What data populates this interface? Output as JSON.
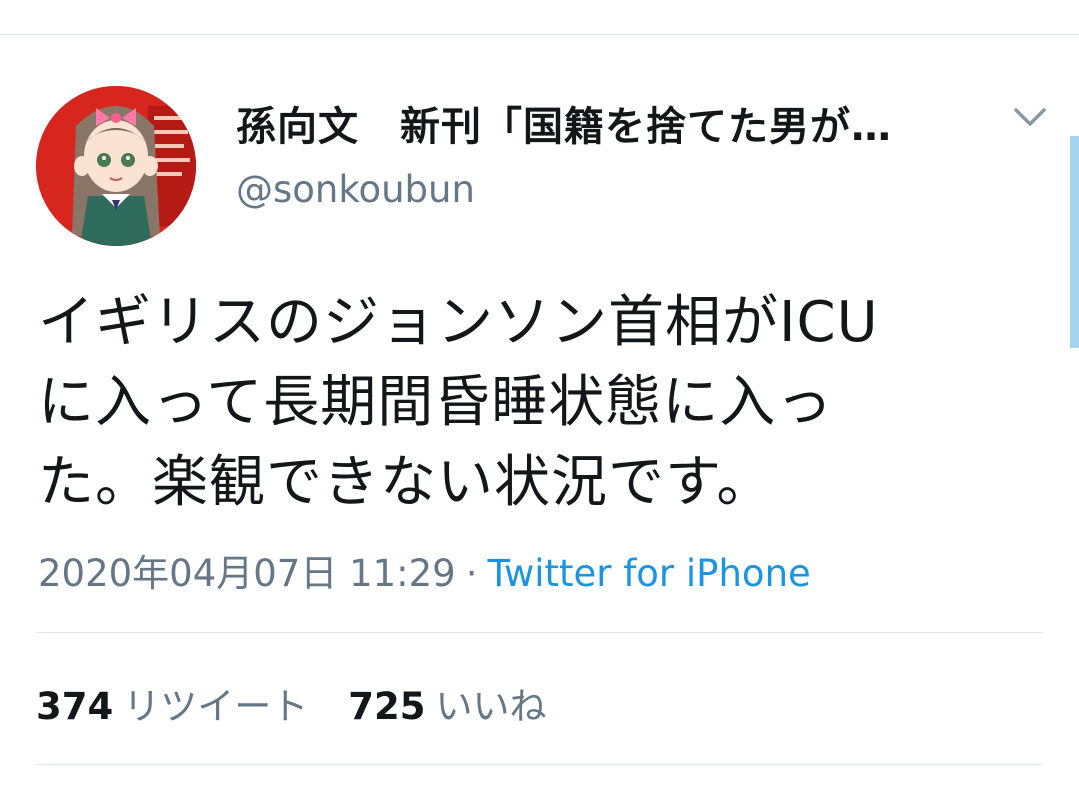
{
  "tweet": {
    "author": {
      "display_name": "孫向文　新刊「国籍を捨てた男が…",
      "handle": "@sonkoubun",
      "avatar_icon": "profile-avatar-illustration"
    },
    "menu_icon": "chevron-down-icon",
    "text_lines": [
      "イギリスのジョンソン首相がICU",
      "に入って長期間昏睡状態に入っ",
      "た。楽観できない状況です。"
    ],
    "timestamp": "2020年04月07日 11:29",
    "separator": "·",
    "source": "Twitter for iPhone",
    "stats": {
      "retweets_count": "374",
      "retweets_label": "リツイート",
      "likes_count": "725",
      "likes_label": "いいね"
    }
  },
  "colors": {
    "text_primary": "#14171a",
    "text_secondary": "#657786",
    "link": "#1b95e0",
    "divider": "#e1e8ed",
    "scrollbar": "#a6d3f2"
  }
}
